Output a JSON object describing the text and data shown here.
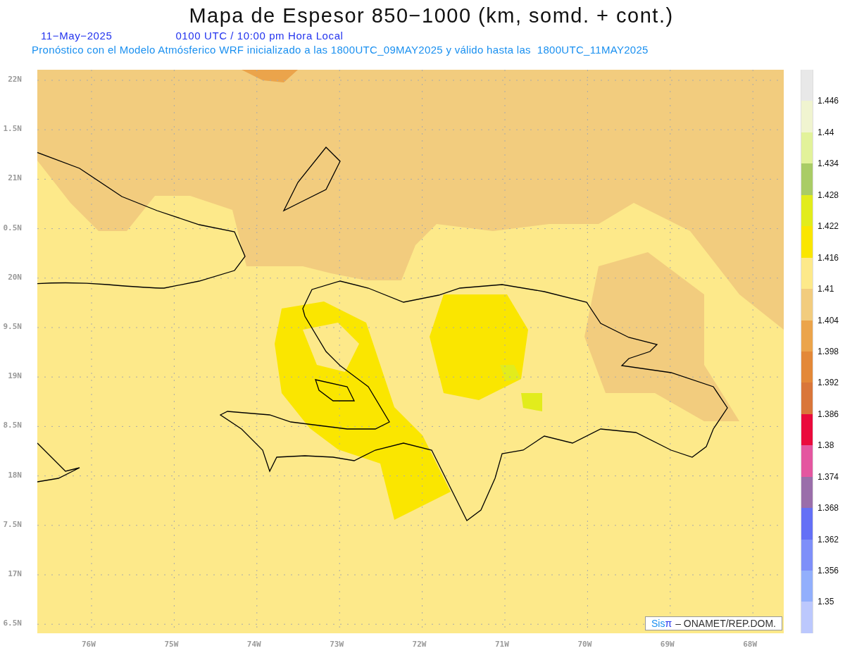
{
  "title": "Mapa de Espesor 850−1000 (km, somd. + cont.)",
  "date": "11−May−2025",
  "time": "0100 UTC / 10:00 pm Hora Local",
  "subtitle": "Pronóstico con el Modelo Atmósferico WRF inicializado a las 1800UTC_09MAY2025 y válido hasta las  1800UTC_11MAY2025",
  "map": {
    "lat_labels": [
      "22N",
      "1.5N",
      "21N",
      "0.5N",
      "20N",
      "9.5N",
      "19N",
      "8.5N",
      "18N",
      "7.5N",
      "17N",
      "6.5N"
    ],
    "lon_labels": [
      "76W",
      "75W",
      "74W",
      "73W",
      "72W",
      "71W",
      "70W",
      "69W",
      "68W"
    ]
  },
  "colorbar": [
    {
      "color": "#e8e8e8",
      "label": "1.446"
    },
    {
      "color": "#f0f4d0",
      "label": "1.44"
    },
    {
      "color": "#e2f29a",
      "label": "1.434"
    },
    {
      "color": "#a9cc66",
      "label": "1.428"
    },
    {
      "color": "#e2ec1c",
      "label": "1.422"
    },
    {
      "color": "#fae600",
      "label": "1.416"
    },
    {
      "color": "#fde98a",
      "label": "1.41"
    },
    {
      "color": "#f2cc7e",
      "label": "1.404"
    },
    {
      "color": "#eba44b",
      "label": "1.398"
    },
    {
      "color": "#e38838",
      "label": "1.392"
    },
    {
      "color": "#d9763a",
      "label": "1.386"
    },
    {
      "color": "#ea0a3c",
      "label": "1.38"
    },
    {
      "color": "#e456a0",
      "label": "1.374"
    },
    {
      "color": "#9a6eaa",
      "label": "1.368"
    },
    {
      "color": "#6470f6",
      "label": "1.362"
    },
    {
      "color": "#7e8ff9",
      "label": "1.356"
    },
    {
      "color": "#92affc",
      "label": "1.35"
    },
    {
      "color": "#bcc8fd"
    }
  ],
  "credit": {
    "brand": "Sis",
    "symbol": "π",
    "text": "– ONAMET/REP.DOM."
  }
}
